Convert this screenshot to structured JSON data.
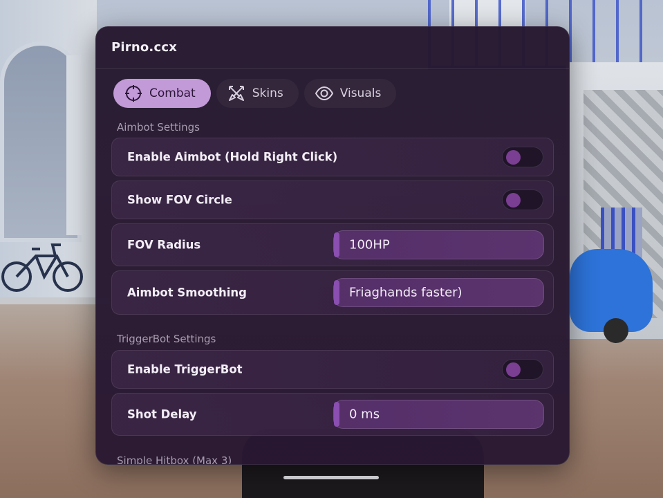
{
  "window": {
    "title": "Pirno.ccx"
  },
  "tabs": [
    {
      "label": "Combat",
      "icon": "crosshair-icon",
      "active": true
    },
    {
      "label": "Skins",
      "icon": "crossed-swords-icon",
      "active": false
    },
    {
      "label": "Visuals",
      "icon": "eye-icon",
      "active": false
    }
  ],
  "sections": {
    "aimbot": {
      "label": "Aimbot Settings",
      "enable_aimbot": {
        "label": "Enable Aimbot (Hold Right Click)",
        "enabled": false
      },
      "show_fov": {
        "label": "Show FOV Circle",
        "enabled": false
      },
      "fov_radius": {
        "label": "FOV Radius",
        "value": "100HP"
      },
      "smoothing": {
        "label": "Aimbot Smoothing",
        "value": "Friaghands faster)"
      }
    },
    "triggerbot": {
      "label": "TriggerBot Settings",
      "enable_triggerbot": {
        "label": "Enable TriggerBot",
        "enabled": false
      },
      "shot_delay": {
        "label": "Shot Delay",
        "value": "0 ms"
      }
    },
    "hitbox": {
      "label": "Simple Hitbox (Max 3)"
    }
  },
  "colors": {
    "accent": "#c29ad8",
    "panel_bg": "#27182f",
    "toggle_knob": "#7a3e92",
    "field_bg": "#663a7e"
  }
}
